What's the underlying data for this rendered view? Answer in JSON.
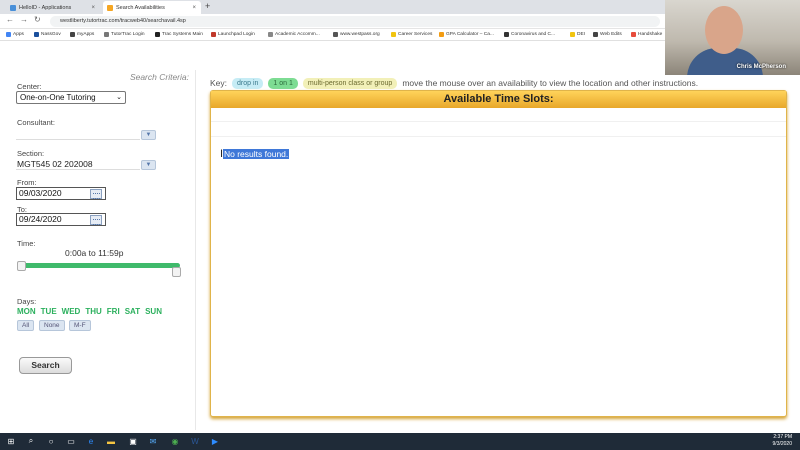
{
  "browser": {
    "tabs": [
      {
        "label": "HelloID - Applications",
        "favicon_color": "#4a90d9"
      },
      {
        "label": "Search Availabilities",
        "favicon_color": "#f5a623"
      }
    ],
    "new_tab_glyph": "+",
    "close_glyph": "×",
    "url": "westliberty.tutortrac.com/tracweb40/searchavail.4sp",
    "bookmarks": [
      {
        "label": "Apps",
        "color": "#4285f4"
      },
      {
        "label": "NassGov",
        "color": "#1a4f9c"
      },
      {
        "label": "myApps",
        "color": "#444"
      },
      {
        "label": "TutorTrac Login",
        "color": "#777"
      },
      {
        "label": "Trac Systems Main",
        "color": "#222"
      },
      {
        "label": "Launchpad Login",
        "color": "#c0392b"
      },
      {
        "label": "Academic Accomm...",
        "color": "#888"
      },
      {
        "label": "www.westpass.org",
        "color": "#555"
      },
      {
        "label": "Career Services",
        "color": "#f1c40f"
      },
      {
        "label": "GPA Calculator – Ca...",
        "color": "#f39c12"
      },
      {
        "label": "Coronavirus and C...",
        "color": "#333"
      },
      {
        "label": "DEI",
        "color": "#f1c40f"
      },
      {
        "label": "Web Edits",
        "color": "#444"
      },
      {
        "label": "Handshake",
        "color": "#e74c3c"
      }
    ]
  },
  "webcam": {
    "name": "Chris McPherson"
  },
  "search": {
    "title": "Search Criteria:",
    "center_label": "Center:",
    "center_value": "One-on-One Tutoring",
    "consultant_label": "Consultant:",
    "consultant_value": "",
    "section_label": "Section:",
    "section_value": "MGT545 02 202008",
    "from_label": "From:",
    "from_value": "09/03/2020",
    "to_label": "To:",
    "to_value": "09/24/2020",
    "time_label": "Time:",
    "time_range": "0:00a to 11:59p",
    "time_start_fraction": 0,
    "time_end_fraction": 1,
    "days_label": "Days:",
    "days": [
      "MON",
      "TUE",
      "WED",
      "THU",
      "FRI",
      "SAT",
      "SUN"
    ],
    "day_buttons": [
      "All",
      "None",
      "M-F"
    ],
    "search_button": "Search"
  },
  "key": {
    "label": "Key:",
    "drop_in": "drop in",
    "one_on_one": "1 on 1",
    "multi": "multi-person class or group",
    "hint": "move the mouse over an availability to view the location and other instructions."
  },
  "results": {
    "title": "Available Time Slots:",
    "message": "No results found."
  },
  "taskbar": {
    "time": "2:37 PM",
    "date": "9/3/2020"
  },
  "colors": {
    "accent_green": "#3fba6b",
    "header_gold": "#e8a72a",
    "selection_blue": "#3f78d8"
  }
}
